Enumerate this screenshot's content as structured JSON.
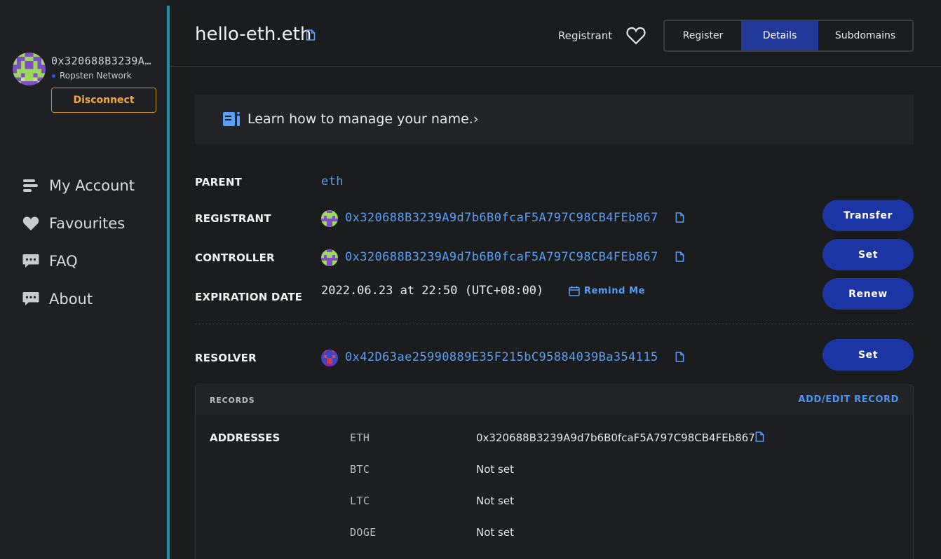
{
  "sidebar": {
    "account_address": "0x320688B3239A9d7b6B0fcaF5A797C98CB4FEb867",
    "network": "Ropsten Network",
    "disconnect_label": "Disconnect",
    "nav": [
      {
        "label": "My Account",
        "icon": "list-icon"
      },
      {
        "label": "Favourites",
        "icon": "heart-icon"
      },
      {
        "label": "FAQ",
        "icon": "chat-icon"
      },
      {
        "label": "About",
        "icon": "chat-icon"
      }
    ]
  },
  "header": {
    "domain": "hello-eth.eth",
    "registrant_label": "Registrant",
    "tabs": {
      "register": "Register",
      "details": "Details",
      "subdomains": "Subdomains"
    }
  },
  "banner": {
    "text": "Learn how to manage your name.",
    "chevron": "›"
  },
  "details": {
    "parent_label": "PARENT",
    "parent_value": "eth",
    "registrant_label": "REGISTRANT",
    "registrant_value": "0x320688B3239A9d7b6B0fcaF5A797C98CB4FEb867",
    "controller_label": "CONTROLLER",
    "controller_value": "0x320688B3239A9d7b6B0fcaF5A797C98CB4FEb867",
    "expiration_label": "EXPIRATION DATE",
    "expiration_value": "2022.06.23 at 22:50 (UTC+08:00)",
    "remind_label": "Remind Me",
    "resolver_label": "RESOLVER",
    "resolver_value": "0x42D63ae25990889E35F215bC95884039Ba354115",
    "buttons": {
      "transfer": "Transfer",
      "set_controller": "Set",
      "renew": "Renew",
      "set_resolver": "Set"
    }
  },
  "records": {
    "title": "RECORDS",
    "add_edit": "ADD/EDIT RECORD",
    "addresses_label": "ADDRESSES",
    "rows": [
      {
        "coin": "ETH",
        "value": "0x320688B3239A9d7b6B0fcaF5A797C98CB4FEb867"
      },
      {
        "coin": "BTC",
        "value": "Not set"
      },
      {
        "coin": "LTC",
        "value": "Not set"
      },
      {
        "coin": "DOGE",
        "value": "Not set"
      }
    ]
  },
  "colors": {
    "accent": "#5a9ef5",
    "button": "#1c35a4",
    "tab_active": "#23399a",
    "disconnect": "#f3a93a",
    "sidebar_edge": "#1f8ea8"
  }
}
